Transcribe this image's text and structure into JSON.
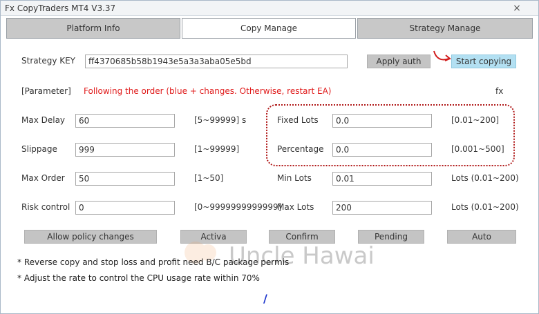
{
  "window": {
    "title": "Fx CopyTraders MT4  V3.37",
    "close_label": "×"
  },
  "tabs": [
    {
      "label": "Platform Info",
      "active": false
    },
    {
      "label": "Copy Manage",
      "active": true
    },
    {
      "label": "Strategy Manage",
      "active": false
    }
  ],
  "strategy": {
    "key_label": "Strategy KEY",
    "key_value": "ff4370685b58b1943e5a3a3aba05e5bd",
    "apply_label": "Apply auth",
    "start_label": "Start copying"
  },
  "parameter": {
    "tag": "[Parameter]",
    "warning": "Following the order (blue + changes. Otherwise, restart EA)",
    "fx_label": "fx"
  },
  "left_fields": [
    {
      "label": "Max Delay",
      "value": "60",
      "range": "[5~99999] s"
    },
    {
      "label": "Slippage",
      "value": "999",
      "range": "[1~99999]"
    },
    {
      "label": "Max Order",
      "value": "50",
      "range": "[1~50]"
    },
    {
      "label": "Risk control",
      "value": "0",
      "range": "[0~9999999999999]"
    }
  ],
  "right_fields": [
    {
      "label": "Fixed Lots",
      "value": "0.0",
      "range": "[0.01~200]"
    },
    {
      "label": "Percentage",
      "value": "0.0",
      "range": "[0.001~500]"
    },
    {
      "label": "Min Lots",
      "value": "0.01",
      "range": "Lots (0.01~200)"
    },
    {
      "label": "Max Lots",
      "value": "200",
      "range": "Lots (0.01~200)"
    }
  ],
  "actions": [
    "Allow policy changes",
    "Activa",
    "Confirm",
    "Pending",
    "Auto"
  ],
  "watermark": "Uncle Hawai",
  "notes": [
    "* Reverse copy and stop loss and profit need B/C package permis",
    "* Adjust the rate to control the CPU usage rate within 70%"
  ],
  "colors": {
    "accent_button": "#b3e0f2",
    "warning_text": "#e01b1b",
    "highlight_frame": "#b01818"
  }
}
